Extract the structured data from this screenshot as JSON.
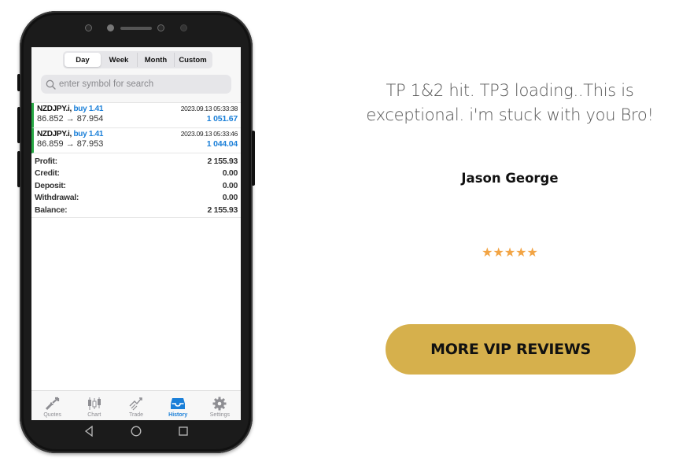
{
  "phone": {
    "segments": [
      {
        "label": "Day",
        "active": true
      },
      {
        "label": "Week",
        "active": false
      },
      {
        "label": "Month",
        "active": false
      },
      {
        "label": "Custom",
        "active": false
      }
    ],
    "search": {
      "placeholder": "enter symbol for search"
    },
    "trades": [
      {
        "symbol": "NZDJPY.i,",
        "direction": "buy 1.41",
        "time": "2023.09.13 05:33:38",
        "prices": "86.852 → 87.954",
        "profit": "1 051.67"
      },
      {
        "symbol": "NZDJPY.i,",
        "direction": "buy 1.41",
        "time": "2023.09.13 05:33:46",
        "prices": "86.859 → 87.953",
        "profit": "1 044.04"
      }
    ],
    "summary": [
      {
        "label": "Profit:",
        "value": "2 155.93"
      },
      {
        "label": "Credit:",
        "value": "0.00"
      },
      {
        "label": "Deposit:",
        "value": "0.00"
      },
      {
        "label": "Withdrawal:",
        "value": "0.00"
      },
      {
        "label": "Balance:",
        "value": "2 155.93"
      }
    ],
    "tabs": [
      {
        "label": "Quotes",
        "icon": "quotes-icon",
        "active": false
      },
      {
        "label": "Chart",
        "icon": "chart-icon",
        "active": false
      },
      {
        "label": "Trade",
        "icon": "trade-icon",
        "active": false
      },
      {
        "label": "History",
        "icon": "history-icon",
        "active": true
      },
      {
        "label": "Settings",
        "icon": "settings-icon",
        "active": false
      }
    ],
    "colors": {
      "accent": "#1a7fd8",
      "buy_bar": "#27a844"
    }
  },
  "testimonial": {
    "quote": "TP 1&2 hit. TP3 loading..This is exceptional. i'm stuck with you Bro!",
    "author": "Jason George",
    "rating": 5,
    "rating_max": 5,
    "star_color": "#f2a444"
  },
  "cta": {
    "label": "MORE VIP REVIEWS",
    "color": "#d6b04c"
  }
}
